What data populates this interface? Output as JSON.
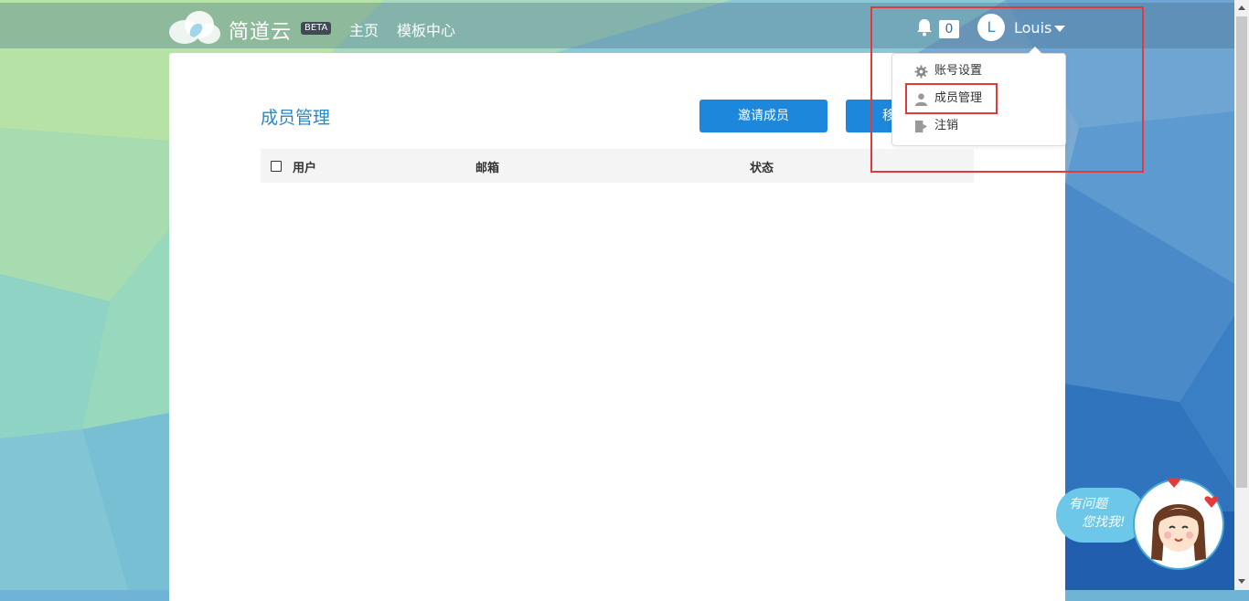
{
  "header": {
    "logo_text": "简道云",
    "beta_label": "BETA",
    "nav": [
      "主页",
      "模板中心"
    ],
    "notification_count": "0",
    "avatar_letter": "L",
    "username": "Louis"
  },
  "main": {
    "page_title": "成员管理",
    "buttons": [
      "邀请成员",
      "移"
    ],
    "table_headers": [
      "用户",
      "邮箱",
      "状态"
    ]
  },
  "dropdown": {
    "items": [
      {
        "label": "账号设置",
        "icon": "gear-icon"
      },
      {
        "label": "成员管理",
        "icon": "user-icon"
      },
      {
        "label": "注销",
        "icon": "logout-icon"
      }
    ]
  },
  "helper": {
    "line1": "有问题",
    "line2": "您找我!"
  },
  "colors": {
    "accent": "#1d87dc",
    "title": "#2a87c4",
    "highlight": "#e03a3a"
  }
}
